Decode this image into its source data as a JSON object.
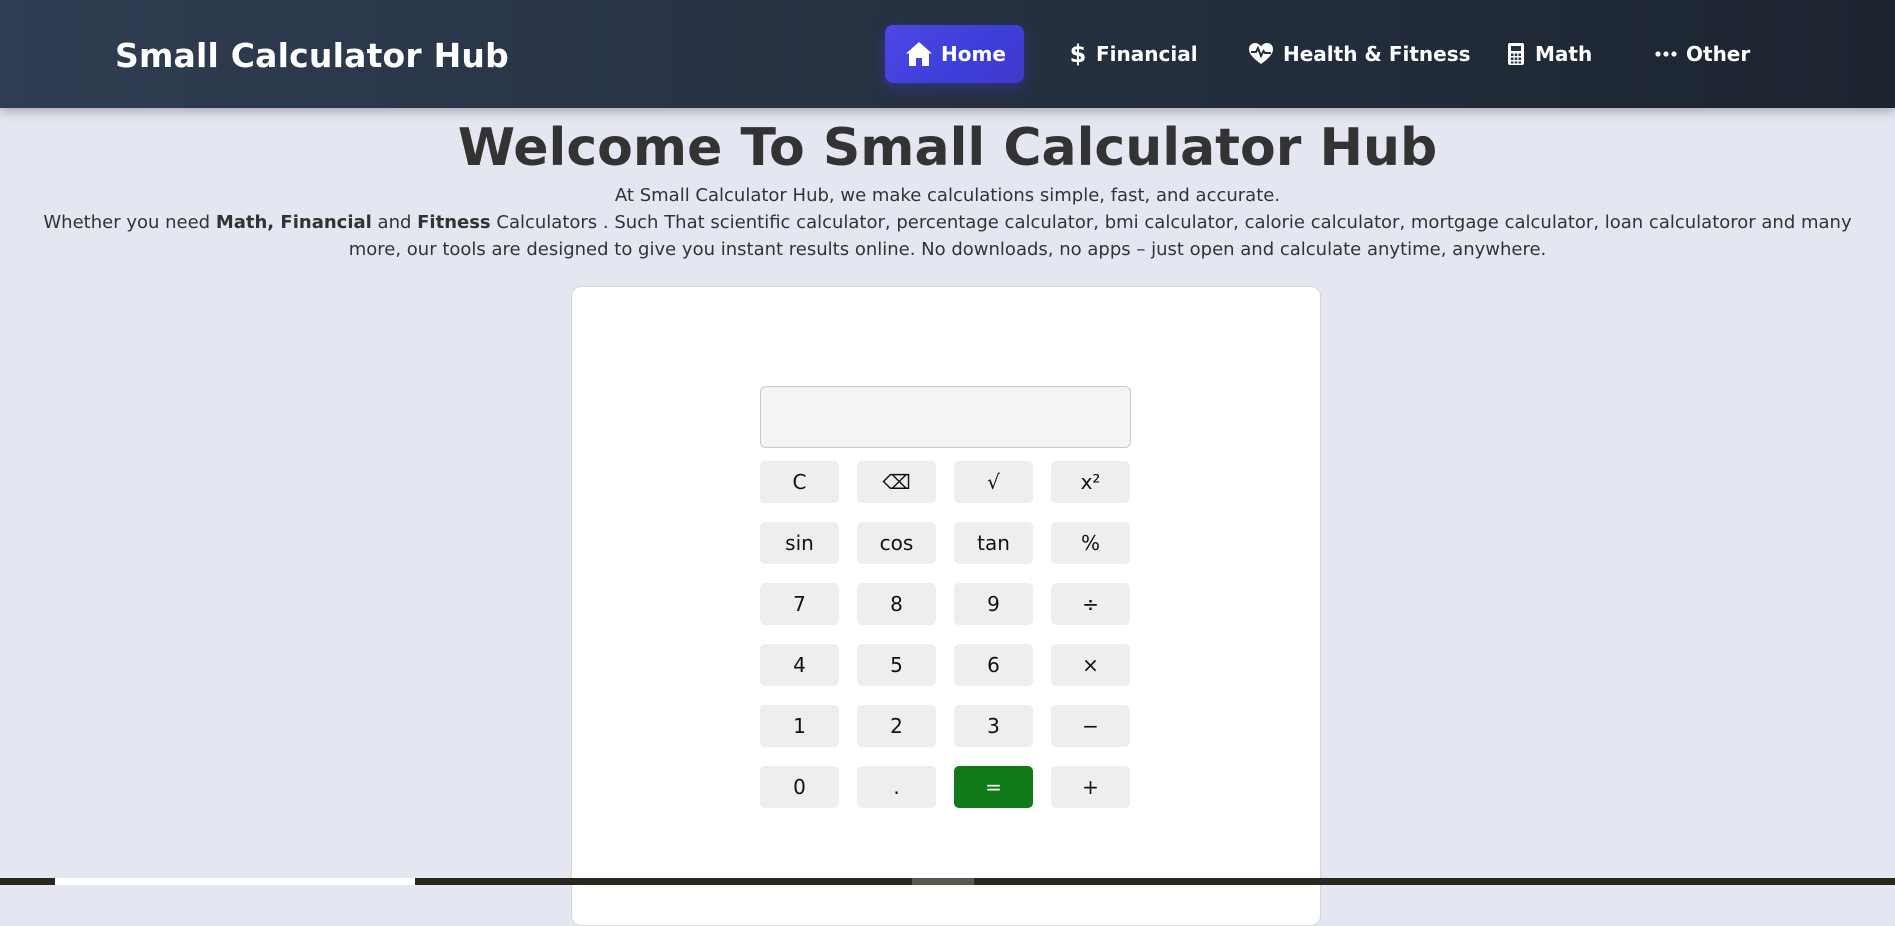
{
  "header": {
    "brand": "Small Calculator Hub",
    "nav": [
      {
        "label": "Home",
        "icon": "home-icon",
        "active": true
      },
      {
        "label": "Financial",
        "icon": "dollar-icon",
        "active": false
      },
      {
        "label": "Health & Fitness",
        "icon": "heartbeat-icon",
        "active": false
      },
      {
        "label": "Math",
        "icon": "calculator-icon",
        "active": false
      },
      {
        "label": "Other",
        "icon": "ellipsis-icon",
        "active": false
      }
    ]
  },
  "intro": {
    "title": "Welcome To Small Calculator Hub",
    "line1": "At Small Calculator Hub, we make calculations simple, fast, and accurate.",
    "line2_prefix": "Whether you need ",
    "line2_bold1": "Math, Financial",
    "line2_mid": " and ",
    "line2_bold2": "Fitness",
    "line2_suffix": " Calculators . Such That scientific calculator, percentage calculator, bmi calculator, calorie calculator, mortgage calculator, loan calculatoror and many more, our tools are designed to give you instant results online. No downloads, no apps – just open and calculate anytime, anywhere."
  },
  "calculator": {
    "display_value": "",
    "keys": [
      "C",
      "⌫",
      "√",
      "x²",
      "sin",
      "cos",
      "tan",
      "%",
      "7",
      "8",
      "9",
      "÷",
      "4",
      "5",
      "6",
      "×",
      "1",
      "2",
      "3",
      "−",
      "0",
      ".",
      "=",
      "+"
    ]
  },
  "colors": {
    "header_bg": "#25303f",
    "active_nav": "#4f46e5",
    "equals_button": "#107a18",
    "page_bg": "#e4e6f1"
  }
}
